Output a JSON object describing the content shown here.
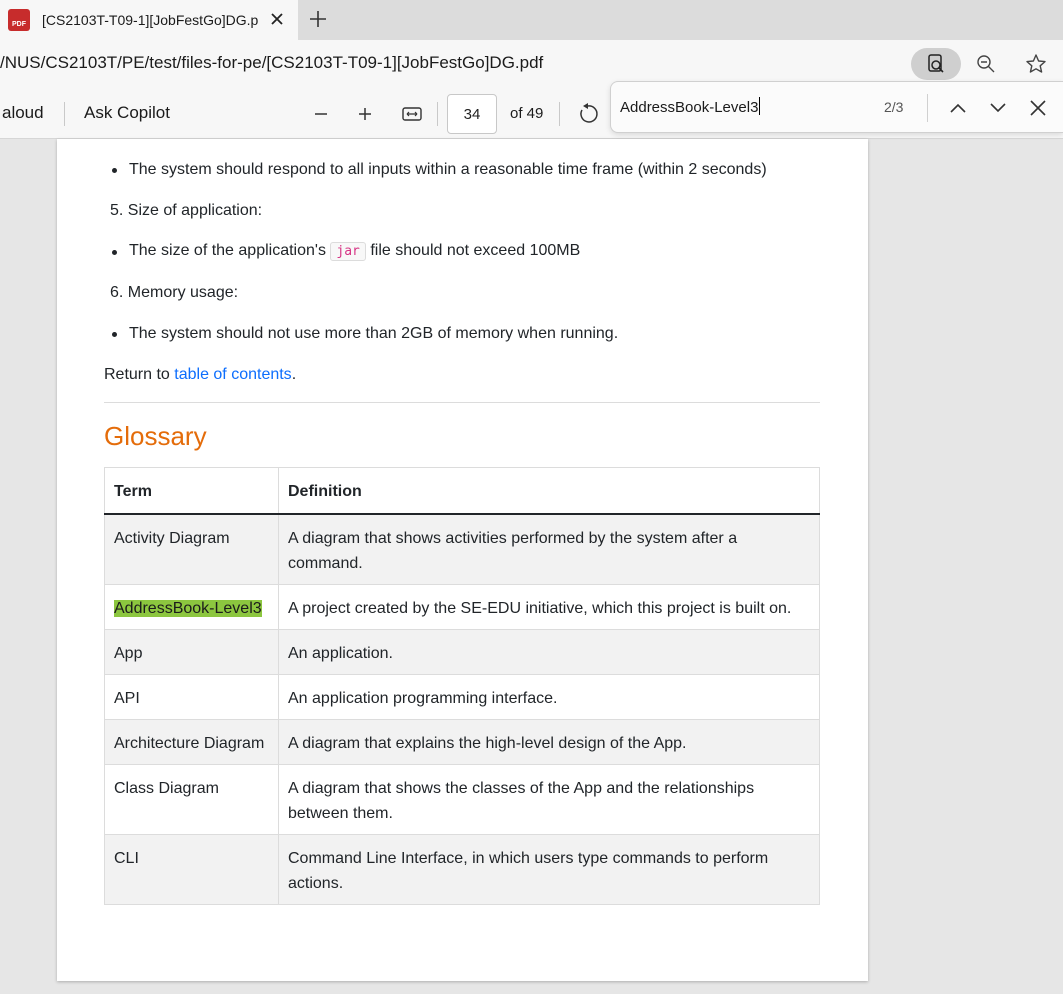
{
  "tab": {
    "title": "[CS2103T-T09-1][JobFestGo]DG.p",
    "icon_label": "PDF"
  },
  "address": {
    "url": "/NUS/CS2103T/PE/test/files-for-pe/[CS2103T-T09-1][JobFestGo]DG.pdf"
  },
  "toolbar": {
    "read_aloud": "aloud",
    "ask_copilot": "Ask Copilot",
    "page_current": "34",
    "page_total": "of 49"
  },
  "find": {
    "query": "AddressBook-Level3",
    "count": "2/3"
  },
  "document": {
    "bullet_response": "The system should respond to all inputs within a reasonable time frame (within 2 seconds)",
    "item5": "5. Size of application:",
    "bullet_size_pre": "The size of the application's",
    "bullet_size_code": "jar",
    "bullet_size_post": "file should not exceed 100MB",
    "item6": "6. Memory usage:",
    "bullet_memory": "The system should not use more than 2GB of memory when running.",
    "return_pre": "Return to",
    "return_link": "table of contents",
    "return_post": ".",
    "heading": "Glossary",
    "table": {
      "headers": [
        "Term",
        "Definition"
      ],
      "rows": [
        {
          "term": "Activity Diagram",
          "def": "A diagram that shows activities performed by the system after a command."
        },
        {
          "term": "AddressBook-Level3",
          "def": "A project created by the SE-EDU initiative, which this project is built on."
        },
        {
          "term": "App",
          "def": "An application."
        },
        {
          "term": "API",
          "def": "An application programming interface."
        },
        {
          "term": "Architecture Diagram",
          "def": "A diagram that explains the high-level design of the App."
        },
        {
          "term": "Class Diagram",
          "def": "A diagram that shows the classes of the App and the relationships between them."
        },
        {
          "term": "CLI",
          "def": "Command Line Interface, in which users type commands to perform actions."
        }
      ]
    }
  },
  "colors": {
    "heading": "#e46c0a",
    "link": "#0d6efd",
    "highlight": "#8cc63f",
    "code": "#d63384"
  }
}
